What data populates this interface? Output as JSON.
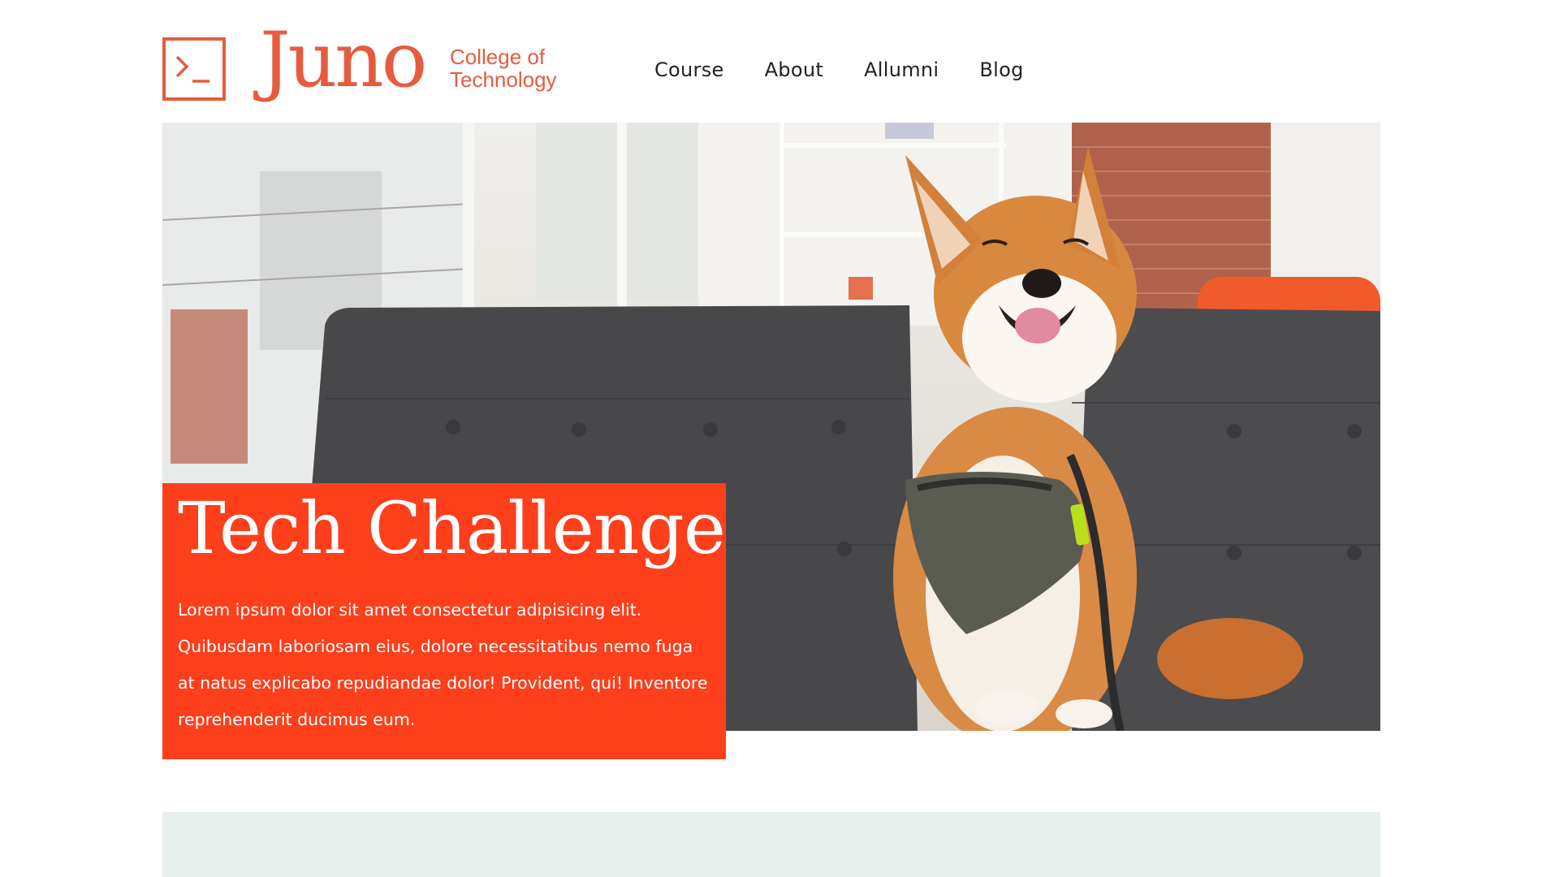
{
  "brand": {
    "name": "Juno",
    "subtitle_line1": "College of",
    "subtitle_line2": "Technology",
    "icon": "terminal-prompt-icon",
    "color": "#e65b3f"
  },
  "nav": {
    "items": [
      "Course",
      "About",
      "Allumni",
      "Blog"
    ]
  },
  "hero": {
    "image": "shiba-inu-dog-on-grey-sofa",
    "title": "Tech Challenge",
    "body": "Lorem ipsum dolor sit amet consectetur adipisicing elit. Quibusdam laboriosam eius, dolore necessitatibus nemo fuga at natus explicabo repudiandae dolor! Provident, qui! Inventore reprehenderit ducimus eum.",
    "callout_color": "#fd3f1c"
  },
  "band": {
    "color": "#e8f0ee"
  }
}
